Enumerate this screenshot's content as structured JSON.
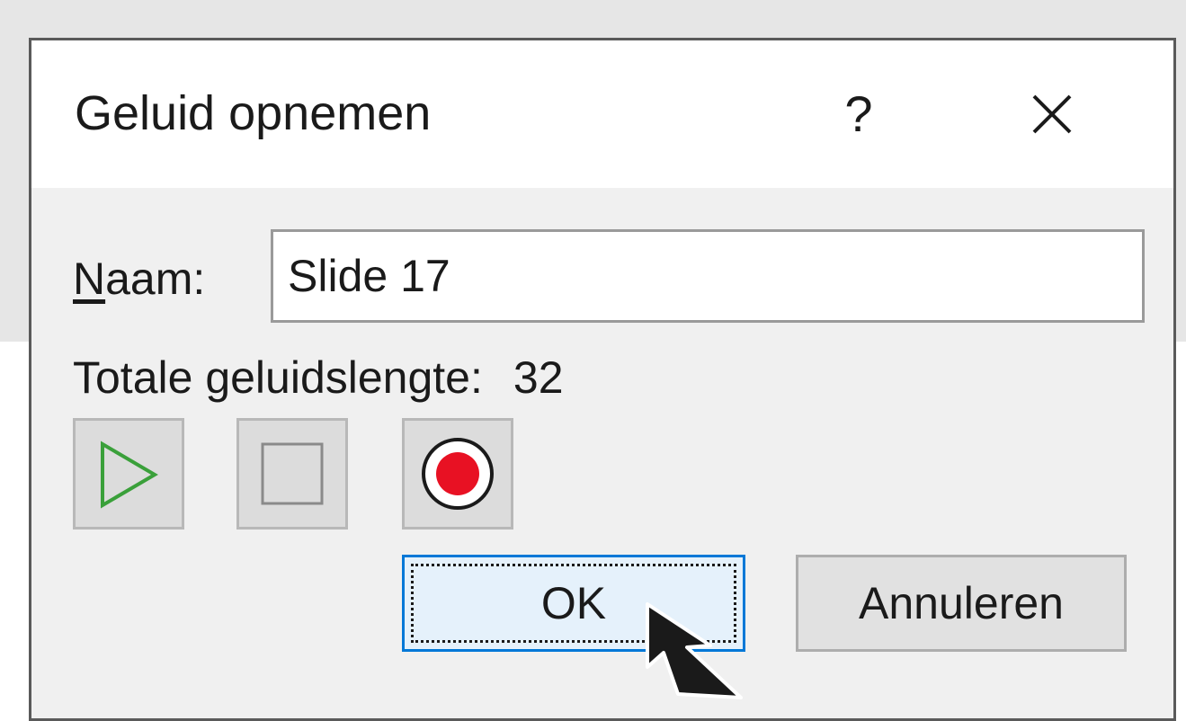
{
  "dialog": {
    "title": "Geluid opnemen",
    "help_glyph": "?"
  },
  "name_field": {
    "label_accel": "N",
    "label_rest": "aam:",
    "value": "Slide 17"
  },
  "sound_length": {
    "label": "Totale geluidslengte:",
    "value": "32"
  },
  "media_controls": {
    "play_icon": "play-icon",
    "stop_icon": "stop-icon",
    "record_icon": "record-icon",
    "play_color": "#3aa03a",
    "record_color": "#e81123"
  },
  "buttons": {
    "ok_label": "OK",
    "cancel_label": "Annuleren"
  },
  "colors": {
    "accent": "#0078d7",
    "dialog_bg": "#f0f0f0",
    "title_bg": "#ffffff"
  }
}
